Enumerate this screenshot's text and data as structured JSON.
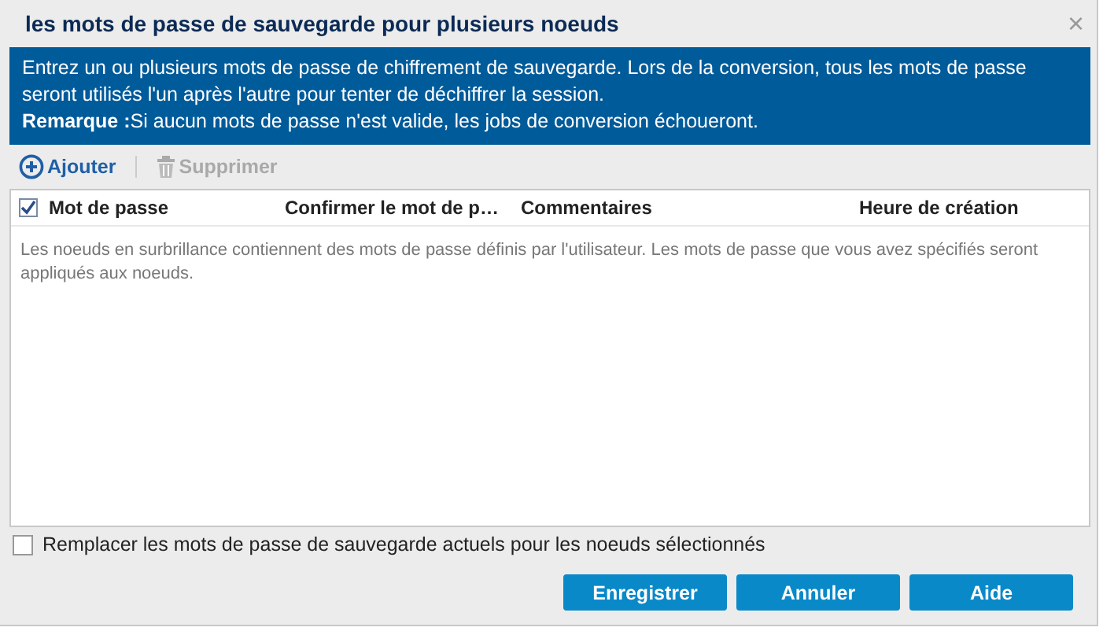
{
  "window": {
    "title": "les mots de passe de sauvegarde pour plusieurs noeuds",
    "close": "×"
  },
  "info": {
    "lines": [
      "Entrez un ou plusieurs mots de passe de chiffrement de sauvegarde. Lors de la conversion, tous les mots de passe seront utilisés l'un après l'autre pour tenter de déchiffrer la session.",
      "**Remarque :**Si aucun mots de passe n'est valide, les jobs de conversion échoueront."
    ]
  },
  "toolbar": [
    {
      "kind": "add",
      "label": "Ajouter",
      "disabled": false
    },
    {
      "kind": "delete",
      "label": "Supprimer",
      "disabled": true
    }
  ],
  "table": {
    "select_all": {
      "checked": true
    },
    "columns": [
      "Mot de passe",
      "Confirmer le mot de p…",
      "Commentaires",
      "Heure de création"
    ],
    "empty_text": "Les noeuds en surbrillance contiennent des mots de passe définis par l'utilisateur. Les mots de passe que vous avez spécifiés seront appliqués aux noeuds."
  },
  "replace_option": {
    "label": "Remplacer les mots de passe de sauvegarde actuels pour les noeuds sélectionnés",
    "checked": false
  },
  "buttons": [
    "Enregistrer",
    "Annuler",
    "Aide"
  ]
}
